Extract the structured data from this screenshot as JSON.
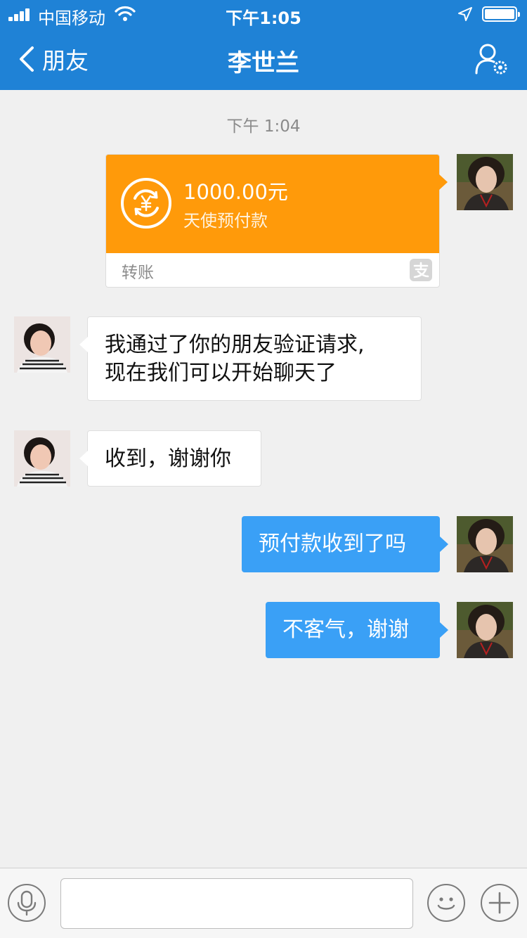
{
  "status_bar": {
    "carrier": "中国移动",
    "time": "下午1:05",
    "battery_level": 1.0
  },
  "nav": {
    "back_label": "朋友",
    "title": "李世兰",
    "settings_icon": "contact-settings-icon"
  },
  "chat": {
    "timestamp": "下午 1:04",
    "transfer": {
      "amount": "1000.00元",
      "description": "天使预付款",
      "footer_label": "转账",
      "icon": "yen-transfer-icon",
      "brand_icon": "alipay-icon",
      "accent_color": "#ff9a0a"
    },
    "messages": [
      {
        "sender": "contact",
        "lines": [
          "我通过了你的朋友验证请求,",
          "现在我们可以开始聊天了"
        ]
      },
      {
        "sender": "contact",
        "text": "收到，谢谢你"
      },
      {
        "sender": "me",
        "text": "预付款收到了吗"
      },
      {
        "sender": "me",
        "text": "不客气，谢谢"
      }
    ],
    "bubble_color_me": "#3aa0f6"
  },
  "input_bar": {
    "voice_icon": "microphone-icon",
    "emoji_icon": "emoji-icon",
    "more_icon": "plus-icon",
    "input_value": ""
  },
  "colors": {
    "header": "#1f82d6",
    "background": "#f0f0f0"
  }
}
